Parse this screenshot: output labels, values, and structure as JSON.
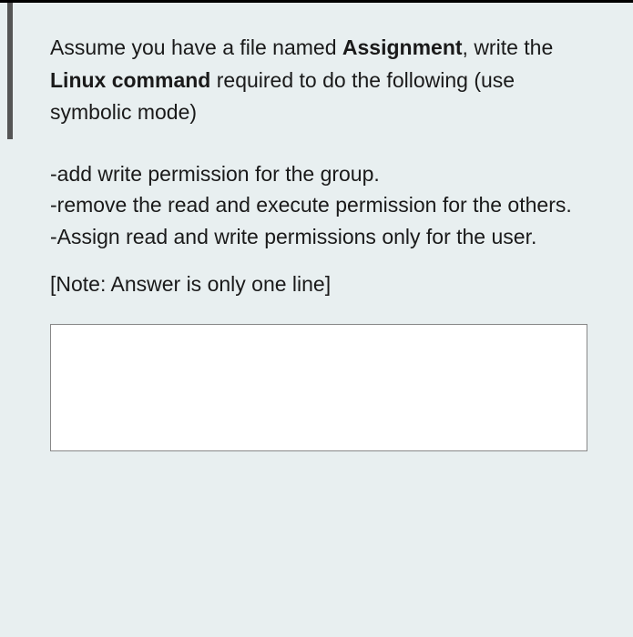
{
  "question": {
    "intro_part1": "Assume you have a file named ",
    "intro_bold1": "Assignment",
    "intro_part2": ", write the ",
    "intro_bold2": "Linux command",
    "intro_part3": " required to do the following (use symbolic mode)",
    "bullets": [
      "-add write permission for the group.",
      "-remove the read and execute permission for the others.",
      "-Assign read and write permissions only for the user."
    ],
    "note": "[Note: Answer is only one line]"
  },
  "answer": {
    "value": "",
    "placeholder": ""
  }
}
